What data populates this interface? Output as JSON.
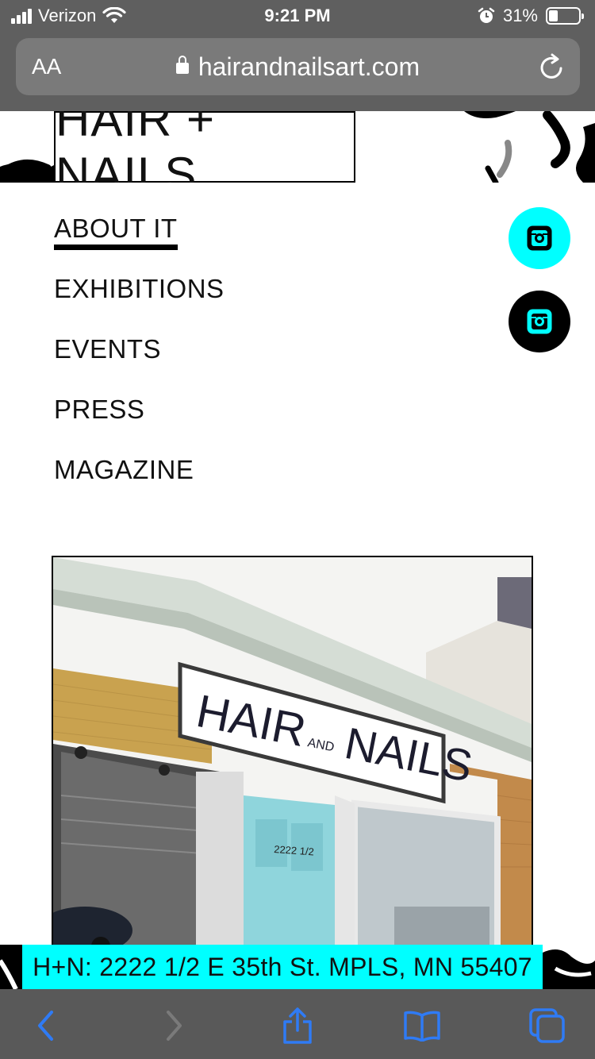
{
  "status_bar": {
    "carrier": "Verizon",
    "time": "9:21 PM",
    "battery": "31%",
    "battery_level": 0.31
  },
  "browser": {
    "text_size_label": "AA",
    "url": "hairandnailsart.com"
  },
  "site": {
    "logo_text": "HAIR + NAILS",
    "nav": [
      {
        "label": "ABOUT IT",
        "active": true
      },
      {
        "label": "EXHIBITIONS"
      },
      {
        "label": "EVENTS"
      },
      {
        "label": "PRESS"
      },
      {
        "label": "MAGAZINE"
      }
    ],
    "photo": {
      "sign_hair": "HAIR",
      "sign_and": "AND",
      "sign_nails": "NAILS",
      "door_number": "2222 1/2"
    },
    "address": "H+N: 2222 1/2 E 35th St. MPLS, MN 55407"
  },
  "colors": {
    "accent": "#00ffff",
    "chrome": "#5f5f5f",
    "toolbar_icon": "#2f7bf5"
  },
  "icons": [
    "signal-icon",
    "wifi-icon",
    "alarm-icon",
    "battery-icon",
    "lock-icon",
    "reload-icon",
    "instagram-icon",
    "back-icon",
    "forward-icon",
    "share-icon",
    "bookmarks-icon",
    "tabs-icon"
  ]
}
